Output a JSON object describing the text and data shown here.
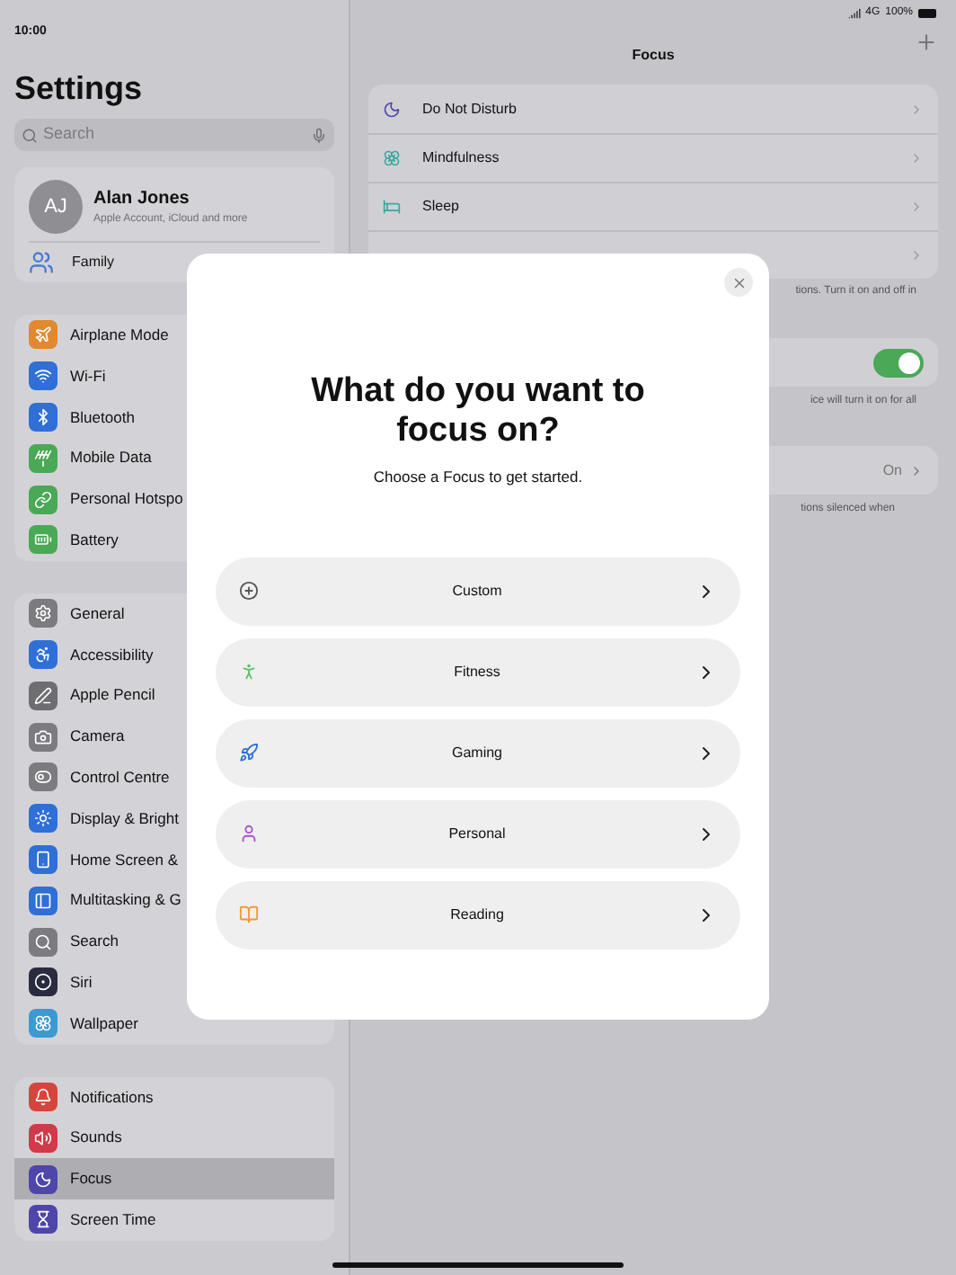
{
  "status_bar": {
    "time": "10:00",
    "network": "4G",
    "battery": "100%"
  },
  "sidebar": {
    "title": "Settings",
    "search": {
      "placeholder": "Search"
    },
    "account": {
      "initials": "AJ",
      "name": "Alan Jones",
      "subtitle": "Apple Account, iCloud and more",
      "family": "Family"
    },
    "groups": [
      [
        {
          "label": "Airplane Mode",
          "color": "#e0892e",
          "selected": false
        },
        {
          "label": "Wi-Fi",
          "color": "#2f6fd6",
          "selected": false
        },
        {
          "label": "Bluetooth",
          "color": "#2f6fd6",
          "selected": false
        },
        {
          "label": "Mobile Data",
          "color": "#4aa857",
          "selected": false
        },
        {
          "label": "Personal Hotspo",
          "color": "#4aa857",
          "selected": false
        },
        {
          "label": "Battery",
          "color": "#4aa857",
          "selected": false
        }
      ],
      [
        {
          "label": "General",
          "color": "#7b7b80",
          "selected": false
        },
        {
          "label": "Accessibility",
          "color": "#2f6fd6",
          "selected": false
        },
        {
          "label": "Apple Pencil",
          "color": "#6d6d72",
          "selected": false
        },
        {
          "label": "Camera",
          "color": "#7b7b80",
          "selected": false
        },
        {
          "label": "Control Centre",
          "color": "#7b7b80",
          "selected": false
        },
        {
          "label": "Display & Bright",
          "color": "#2f6fd6",
          "selected": false
        },
        {
          "label": "Home Screen &",
          "color": "#2f6fd6",
          "selected": false
        },
        {
          "label": "Multitasking & G",
          "color": "#2f6fd6",
          "selected": false
        },
        {
          "label": "Search",
          "color": "#7b7b80",
          "selected": false
        },
        {
          "label": "Siri",
          "color": "#2a2a40",
          "selected": false
        },
        {
          "label": "Wallpaper",
          "color": "#3c9ad0",
          "selected": false
        }
      ],
      [
        {
          "label": "Notifications",
          "color": "#d6453d",
          "selected": false
        },
        {
          "label": "Sounds",
          "color": "#d03a4a",
          "selected": false
        },
        {
          "label": "Focus",
          "color": "#4e46a8",
          "selected": true
        },
        {
          "label": "Screen Time",
          "color": "#4e46a8",
          "selected": false
        }
      ]
    ]
  },
  "detail": {
    "title": "Focus",
    "focus_list": [
      {
        "label": "Do Not Disturb",
        "color": "#4e46a8"
      },
      {
        "label": "Mindfulness",
        "color": "#3aa6a0"
      },
      {
        "label": "Sleep",
        "color": "#3aa6a0"
      }
    ],
    "note_1": "tions. Turn it on and off in",
    "toggle": {
      "on": true
    },
    "note_2": "ice will turn it on for all",
    "status_row": {
      "value": "On"
    },
    "note_3": "tions silenced when"
  },
  "dialog": {
    "title": "What do you want to focus on?",
    "subtitle": "Choose a Focus to get started.",
    "options": [
      {
        "label": "Custom",
        "color": "#555558"
      },
      {
        "label": "Fitness",
        "color": "#5cc06a"
      },
      {
        "label": "Gaming",
        "color": "#2f6fd6"
      },
      {
        "label": "Personal",
        "color": "#a64fd0"
      },
      {
        "label": "Reading",
        "color": "#ef9a35"
      }
    ]
  }
}
